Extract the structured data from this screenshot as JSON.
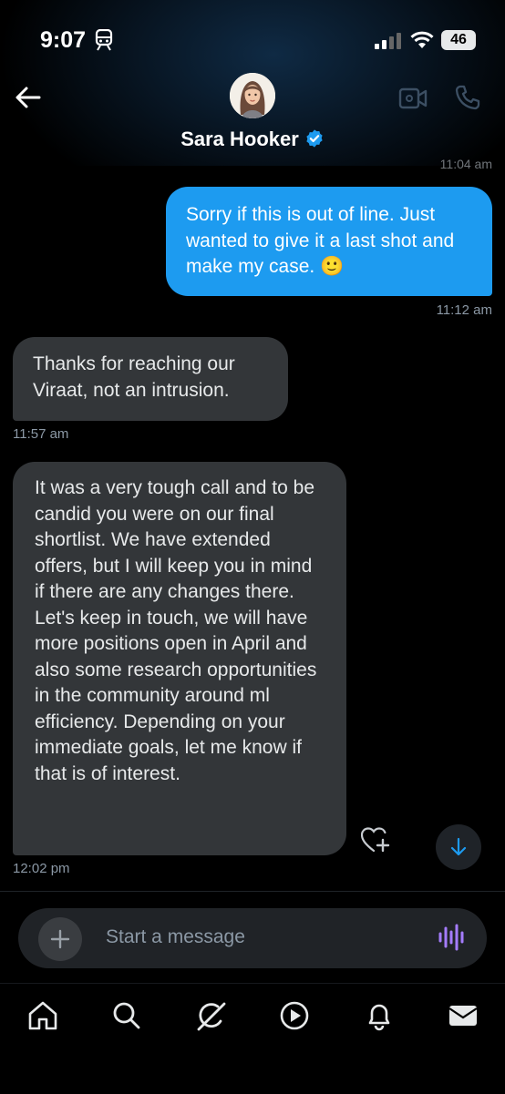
{
  "status_bar": {
    "time": "9:07",
    "battery": "46"
  },
  "header": {
    "name": "Sara Hooker",
    "verified": true,
    "previous_timestamp": "11:04 am"
  },
  "messages": [
    {
      "direction": "sent",
      "text": "Sorry if this is out of line. Just wanted to give it a last shot and make my case. 🙂",
      "timestamp": "11:12 am"
    },
    {
      "direction": "received",
      "text": "Thanks for reaching our Viraat, not an intrusion.",
      "timestamp": "11:57 am"
    },
    {
      "direction": "received",
      "text": "It was a very tough call and to be candid you were on our final shortlist. We have extended offers, but I will keep you in mind if there are any changes there. Let's keep in touch, we will have more positions open in April and also some research opportunities in the community around ml efficiency. Depending on your immediate goals, let me know if that is of interest.",
      "timestamp": "12:02 pm"
    }
  ],
  "composer": {
    "placeholder": "Start a message"
  },
  "icons": [
    "back-arrow-icon",
    "video-call-icon",
    "phone-call-icon",
    "verified-badge-icon",
    "heart-plus-icon",
    "arrow-down-icon",
    "plus-icon",
    "voice-message-icon",
    "home-icon",
    "search-icon",
    "grok-icon",
    "video-play-icon",
    "notifications-bell-icon",
    "mail-icon"
  ],
  "colors": {
    "accent": "#1d9bf0",
    "received_bubble": "#333639",
    "voice_icon": "#a57cff"
  }
}
